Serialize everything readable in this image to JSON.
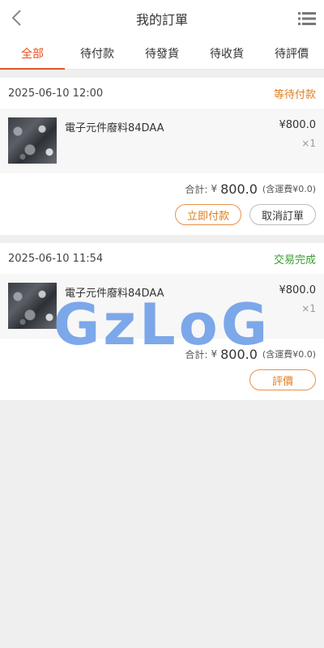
{
  "header": {
    "title": "我的訂單",
    "back_icon": "chevron-left-icon",
    "menu_icon": "list-menu-icon"
  },
  "tabs": [
    {
      "label": "全部",
      "active": true
    },
    {
      "label": "待付款",
      "active": false
    },
    {
      "label": "待發貨",
      "active": false
    },
    {
      "label": "待收貨",
      "active": false
    },
    {
      "label": "待評價",
      "active": false
    }
  ],
  "orders": [
    {
      "time": "2025-06-10 12:00",
      "status": "等待付款",
      "item": {
        "name": "電子元件廢料84DAA",
        "price": "¥800.0",
        "qty": "×1"
      },
      "summary": {
        "label": "合計:",
        "currency": "¥",
        "amount": "800.0",
        "shipping": "(含運費¥0.0)"
      },
      "actions": [
        "立即付款",
        "取消訂單"
      ]
    },
    {
      "time": "2025-06-10 11:54",
      "status": "交易完成",
      "item": {
        "name": "電子元件廢料84DAA",
        "price": "¥800.0",
        "qty": "×1"
      },
      "summary": {
        "label": "合計:",
        "currency": "¥",
        "amount": "800.0",
        "shipping": "(含運費¥0.0)"
      },
      "actions": [
        "評價"
      ]
    }
  ],
  "watermark": "GzLoG",
  "colors": {
    "accent": "#e8501e",
    "pending": "#e07d1c",
    "done": "#3a9d2f"
  }
}
